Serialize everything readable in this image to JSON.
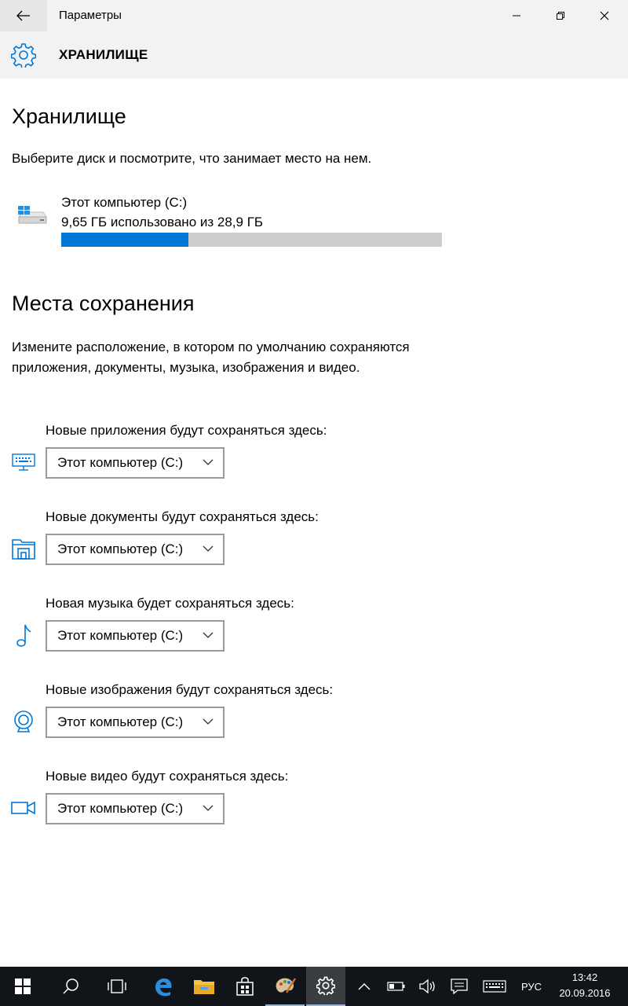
{
  "window": {
    "app_title": "Параметры",
    "header_title": "ХРАНИЛИЩЕ"
  },
  "storage": {
    "heading": "Хранилище",
    "description": "Выберите диск и посмотрите, что занимает место на нем.",
    "drive": {
      "name": "Этот компьютер (C:)",
      "usage": "9,65 ГБ использовано из 28,9 ГБ",
      "used_fraction": 0.334
    }
  },
  "save_locations": {
    "heading": "Места сохранения",
    "description": "Измените расположение, в котором по умолчанию сохраняются приложения, документы, музыка, изображения и видео.",
    "items": [
      {
        "label": "Новые приложения будут сохраняться здесь:",
        "value": "Этот компьютер (C:)",
        "icon": "apps-icon"
      },
      {
        "label": "Новые документы будут сохраняться здесь:",
        "value": "Этот компьютер (C:)",
        "icon": "documents-icon"
      },
      {
        "label": "Новая музыка будет сохраняться здесь:",
        "value": "Этот компьютер (C:)",
        "icon": "music-icon"
      },
      {
        "label": "Новые изображения будут сохраняться здесь:",
        "value": "Этот компьютер (C:)",
        "icon": "pictures-icon"
      },
      {
        "label": "Новые видео будут сохраняться здесь:",
        "value": "Этот компьютер (C:)",
        "icon": "video-icon"
      }
    ]
  },
  "taskbar": {
    "language": "РУС",
    "time": "13:42",
    "date": "20.09.2016"
  },
  "colors": {
    "accent": "#0078d7",
    "taskbar": "#111418"
  }
}
